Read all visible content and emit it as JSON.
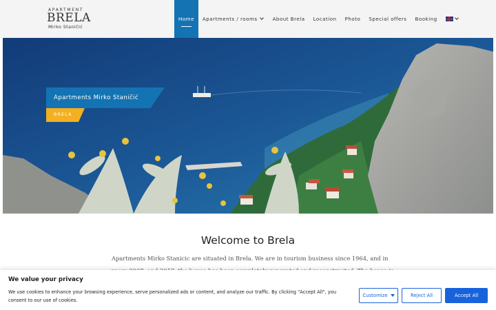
{
  "header": {
    "logo": {
      "line1": "APARTMENT",
      "line2": "BRELA",
      "line3": "Mirko Staničić"
    },
    "nav": [
      {
        "label": "Home",
        "active": true
      },
      {
        "label": "Apartments / rooms",
        "dropdown": true
      },
      {
        "label": "About Brela"
      },
      {
        "label": "Location"
      },
      {
        "label": "Photo"
      },
      {
        "label": "Special offers"
      },
      {
        "label": "Booking"
      }
    ],
    "language_icon": "uk-flag-icon"
  },
  "hero": {
    "title": "Apartments Mirko Staničić",
    "tag": "BRELA"
  },
  "welcome": {
    "title": "Welcome to Brela",
    "line1": "Apartments Mirko Stanicic are situated in Brela. We are in tourism business since 1964, and in",
    "line2": "years 2007. and 2017. the house has been completely renovated and reconstructed. The house is"
  },
  "cookie": {
    "title": "We value your privacy",
    "text": "We use cookies to enhance your browsing experience, serve personalized ads or content, and analyze our traffic. By clicking \"Accept All\", you consent to our use of cookies.",
    "customize": "Customize",
    "reject": "Reject All",
    "accept": "Accept All"
  },
  "colors": {
    "accent": "#1373b3",
    "tag": "#f3b021",
    "button": "#1863dc"
  }
}
